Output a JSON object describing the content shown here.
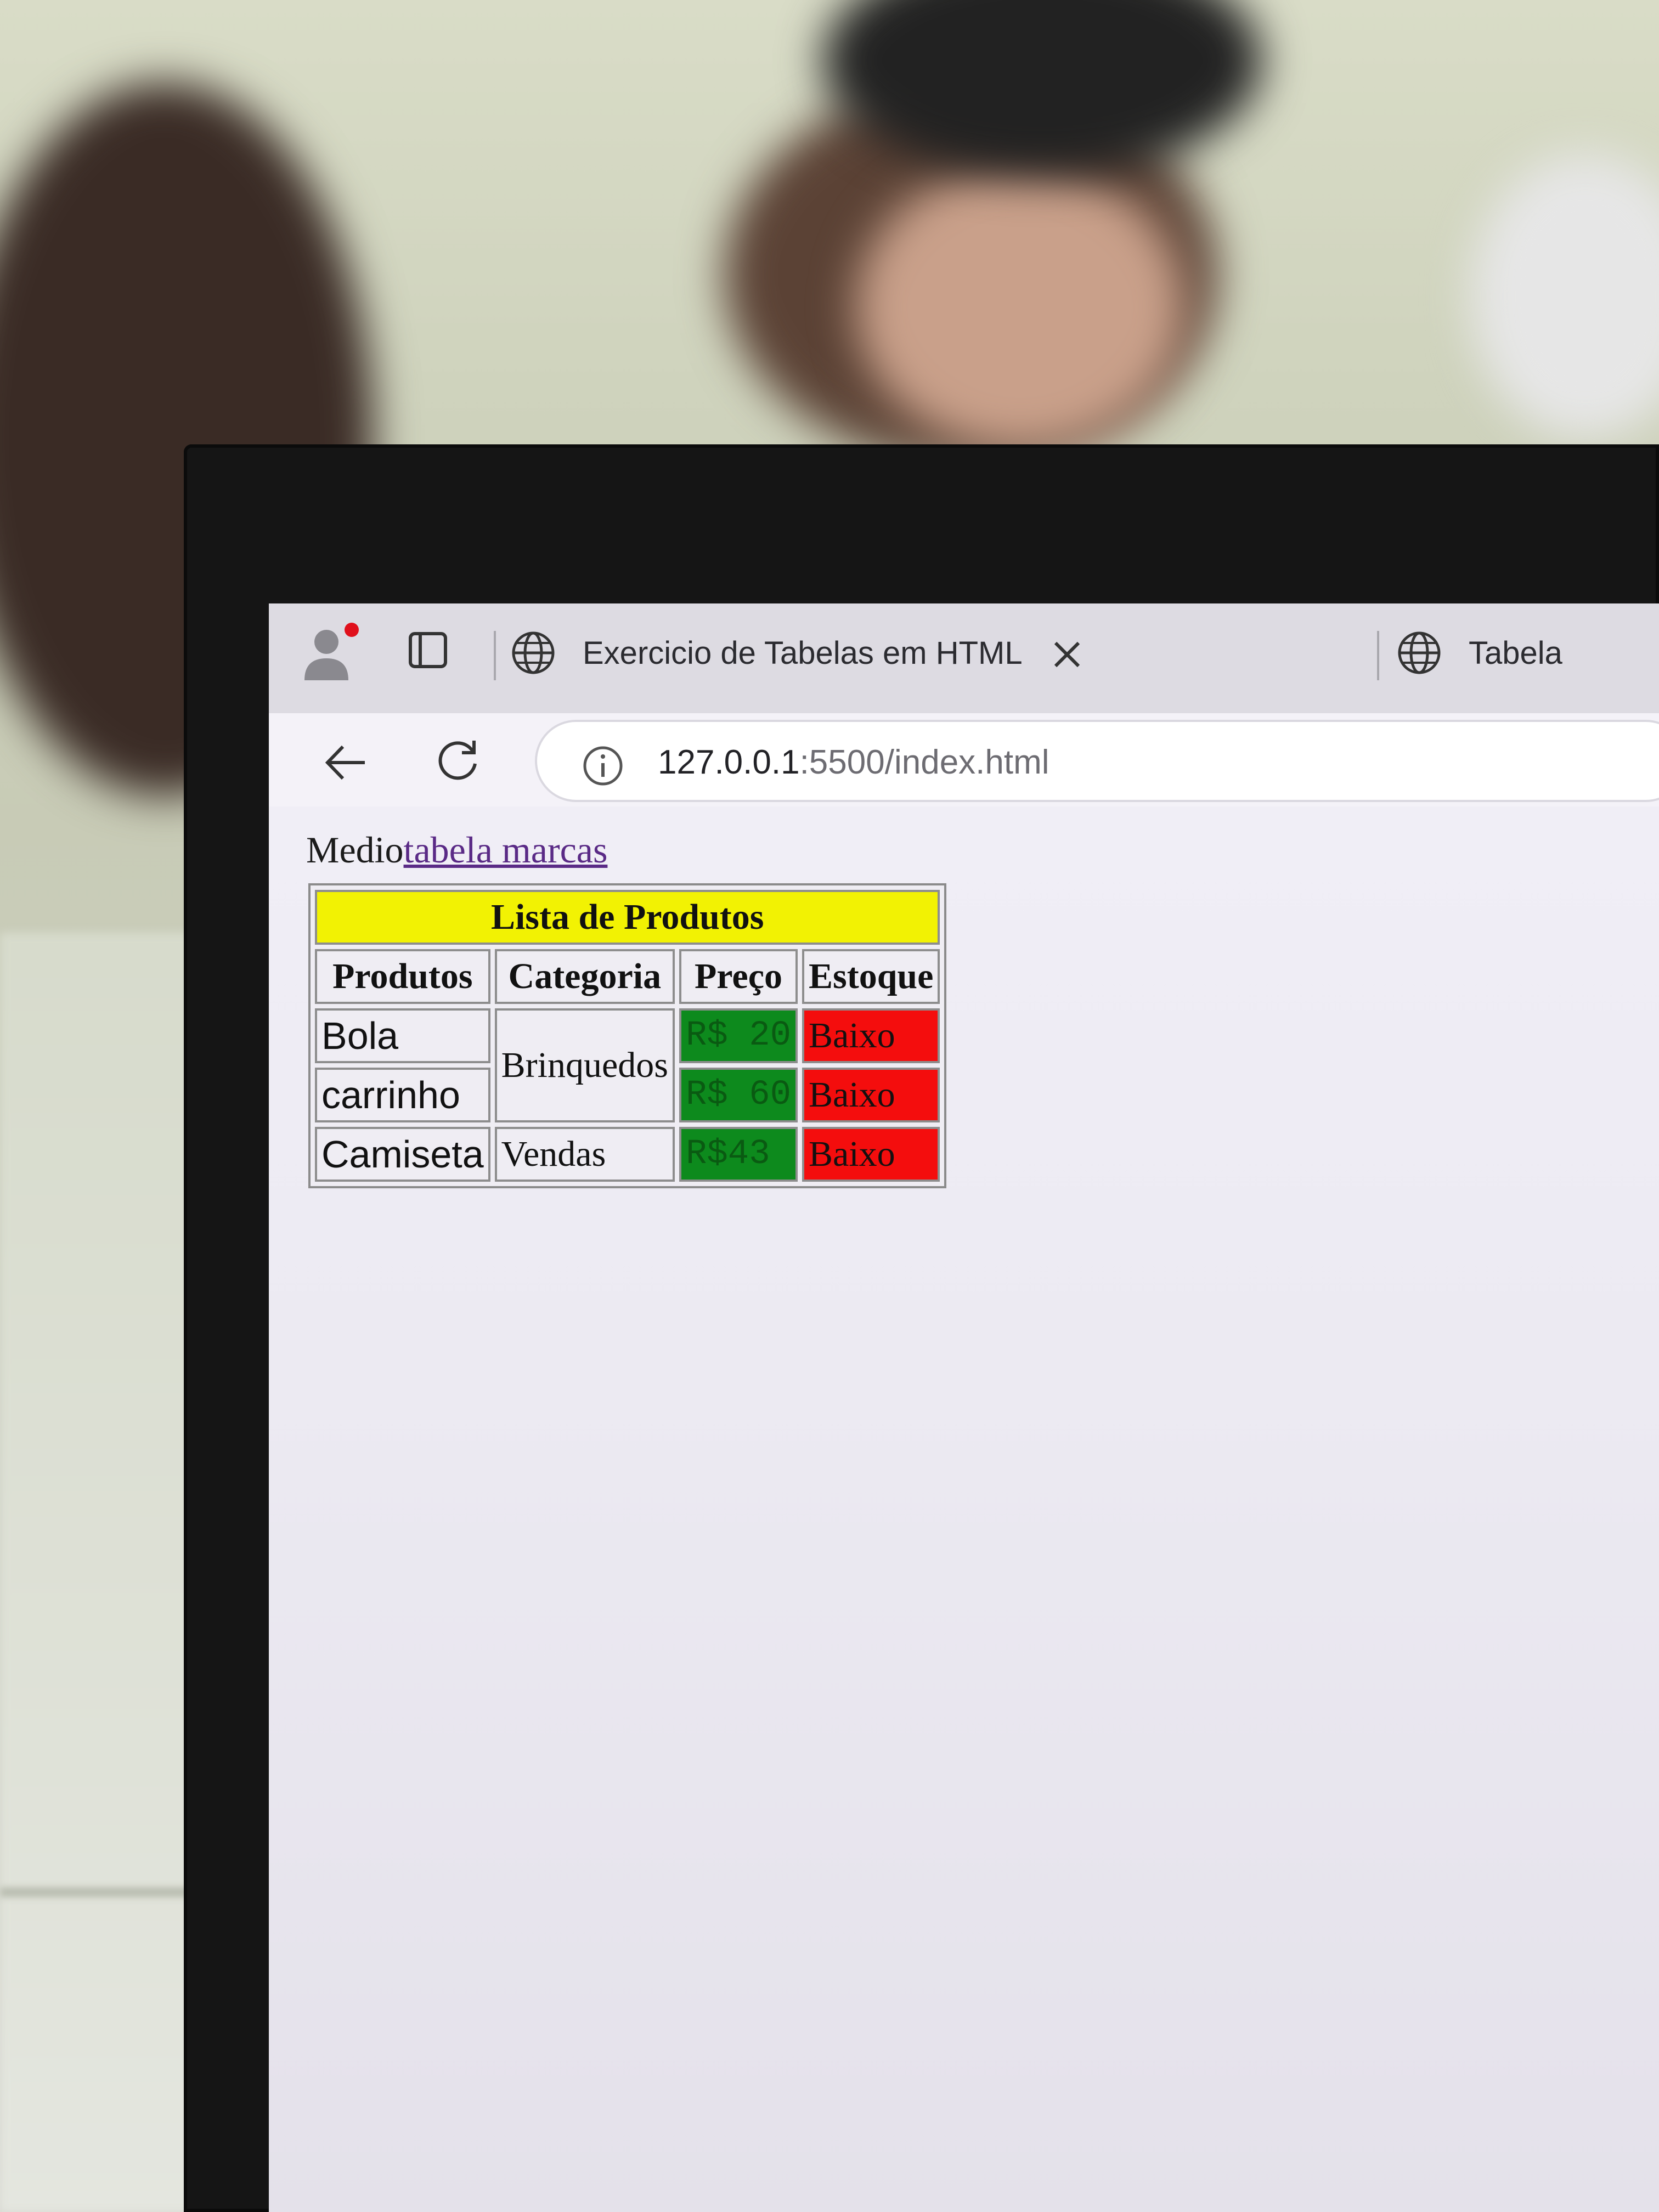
{
  "browser": {
    "tabs": [
      {
        "title": "Exercicio de Tabelas em HTML",
        "active": true
      },
      {
        "title": "Tabela",
        "active": false
      }
    ],
    "address_bar": {
      "url_host": "127.0.0.1",
      "url_rest": ":5500/index.html"
    }
  },
  "page": {
    "lead_text": "Medio",
    "link_text": "tabela marcas",
    "table": {
      "caption": "Lista de Produtos",
      "headers": [
        "Produtos",
        "Categoria",
        "Preço",
        "Estoque"
      ],
      "rows": [
        {
          "produto": "Bola",
          "categoria": "Brinquedos",
          "preco": "R$ 20",
          "estoque": "Baixo"
        },
        {
          "produto": "carrinho",
          "preco": "R$ 60",
          "estoque": "Baixo"
        },
        {
          "produto": "Camiseta",
          "categoria": "Vendas",
          "preco": "R$43",
          "estoque": "Baixo"
        }
      ]
    }
  },
  "colors": {
    "caption_bg": "#f2f203",
    "price_bg": "#0d8a1d",
    "stock_bg": "#f40d0d",
    "link": "#5a2a86"
  },
  "icons": {
    "profile": "profile-icon",
    "tab_actions": "tab-actions-icon",
    "tab_favicon": "globe-icon",
    "tab_close": "close-icon",
    "back": "back-arrow-icon",
    "reload": "reload-icon",
    "site_info": "info-icon"
  }
}
